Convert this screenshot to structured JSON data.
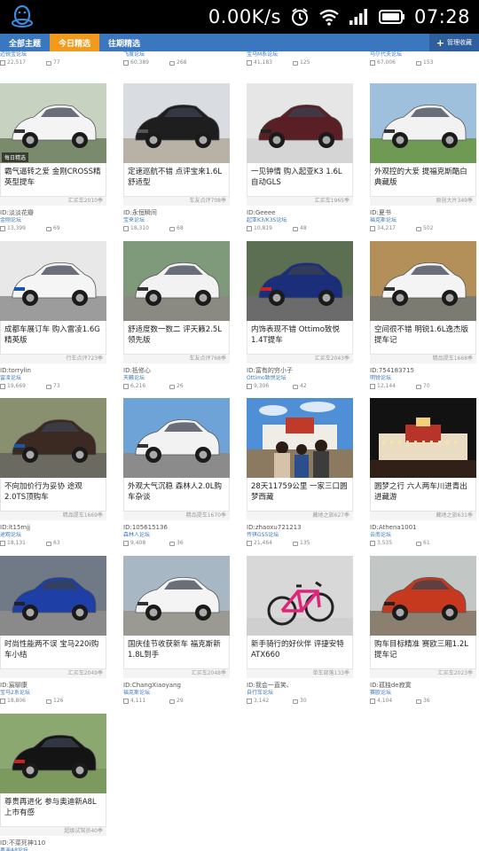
{
  "status_bar": {
    "speed": "0.00K/s",
    "time": "07:28"
  },
  "tabs": [
    {
      "label": "全部主题"
    },
    {
      "label": "今日精选"
    },
    {
      "label": "往期精选"
    }
  ],
  "manage_label": "管理收藏",
  "top_row": [
    {
      "forum": "迈锐宝论坛",
      "views": "22,517",
      "comments": "77"
    },
    {
      "forum": "飞度论坛",
      "views": "60,389",
      "comments": "268"
    },
    {
      "forum": "宝马M系论坛",
      "views": "41,183",
      "comments": "125"
    },
    {
      "forum": "马尔代夫论坛",
      "views": "67,006",
      "comments": "153"
    }
  ],
  "cards": [
    {
      "title": "霸气逼转之爱 金刚CROSS精英型提车",
      "tag": "汇买车2010季",
      "author": "ID:淡淡花瓣",
      "forum": "金刚论坛",
      "views": "13,399",
      "comments": "69",
      "badge": "每日精选",
      "photo": "white-suv"
    },
    {
      "title": "定速巡航不错 点评宝来1.6L舒适型",
      "tag": "车友点评708季",
      "author": "ID:永恒瞬间",
      "forum": "宝来论坛",
      "views": "18,310",
      "comments": "68",
      "photo": "black-sedan"
    },
    {
      "title": "一见钟情 购入起亚K3 1.6L自动GLS",
      "tag": "汇买车1965季",
      "author": "ID:Geeee",
      "forum": "起亚K3/K3S论坛",
      "views": "10,819",
      "comments": "48",
      "photo": "maroon-sedan"
    },
    {
      "title": "外观控的大爱 提福克斯酷白典藏版",
      "tag": "原创大片349季",
      "author": "ID:夏书",
      "forum": "福克斯论坛",
      "views": "34,217",
      "comments": "502",
      "photo": "white-hatch"
    },
    {
      "title": "成都车展订车 购入雷凌1.6G精英版",
      "tag": "行车点评723季",
      "author": "ID:torrylin",
      "forum": "雷凌论坛",
      "views": "19,669",
      "comments": "73",
      "photo": "white-corolla"
    },
    {
      "title": "舒适度数一数二 评天籁2.5L领先版",
      "tag": "车友点评768季",
      "author": "ID:抵修心",
      "forum": "天籁论坛",
      "views": "6,216",
      "comments": "26",
      "photo": "white-teana"
    },
    {
      "title": "内饰表现不错 Ottimo致悦1.4T提车",
      "tag": "汇买车2043季",
      "author": "ID:富有的穷小子",
      "forum": "Ottimo致悦论坛",
      "views": "9,306",
      "comments": "42",
      "photo": "blue-ottimo"
    },
    {
      "title": "空间很不错 明锐1.6L逸杰版提车记",
      "tag": "精品提车1668季",
      "author": "ID:754183715",
      "forum": "明锐论坛",
      "views": "12,144",
      "comments": "70",
      "photo": "white-octavia"
    },
    {
      "title": "不向加价行为妥协 途观2.0TS顶购车",
      "tag": "精品提车1669季",
      "author": "ID:lt15mjj",
      "forum": "途观论坛",
      "views": "18,131",
      "comments": "63",
      "photo": "brown-tiguan"
    },
    {
      "title": "外观大气沉稳 森林人2.0L购车杂谈",
      "tag": "精品提车1670季",
      "author": "ID:105615136",
      "forum": "森林人论坛",
      "views": "9,408",
      "comments": "36",
      "photo": "white-forester"
    },
    {
      "title": "28天11759公里 一家三口圆梦西藏",
      "tag": "藏地之旅627季",
      "author": "ID:zhaoxu721213",
      "forum": "传祺GS5论坛",
      "views": "21,464",
      "comments": "135",
      "photo": "potala-family"
    },
    {
      "title": "圆梦之行 六人两车川进青出进藏游",
      "tag": "藏地之旅631季",
      "author": "ID:Athena1001",
      "forum": "云南论坛",
      "views": "3,535",
      "comments": "61",
      "photo": "potala-night"
    },
    {
      "title": "时尚性能两不误 宝马220i购车小结",
      "tag": "汇买车2049季",
      "author": "ID:宸聊康",
      "forum": "宝马2系论坛",
      "views": "18,806",
      "comments": "126",
      "photo": "blue-bmw"
    },
    {
      "title": "国庆佳节收获新车 福克斯新1.8L到手",
      "tag": "汇买车2048季",
      "author": "ID:ChangXiaoyang",
      "forum": "福克斯论坛",
      "views": "4,111",
      "comments": "29",
      "photo": "white-focus"
    },
    {
      "title": "新手骑行的好伙伴 评捷安特ATX660",
      "tag": "单车部落133季",
      "author": "ID:我会一直笑、",
      "forum": "自行车论坛",
      "views": "3,142",
      "comments": "30",
      "photo": "pink-bike"
    },
    {
      "title": "购车目标精准 赛欧三厢1.2L提车记",
      "tag": "汇买车2023季",
      "author": "ID:孤独de寂寞",
      "forum": "赛欧论坛",
      "views": "4,104",
      "comments": "36",
      "photo": "orange-sail"
    },
    {
      "title": "尊贵再进化 参与奥迪新A8L上市有感",
      "tag": "超级试驾员40季",
      "author": "ID:不菜死神110",
      "forum": "奥迪A8论坛",
      "views": "",
      "comments": "",
      "photo": "black-audi"
    }
  ]
}
